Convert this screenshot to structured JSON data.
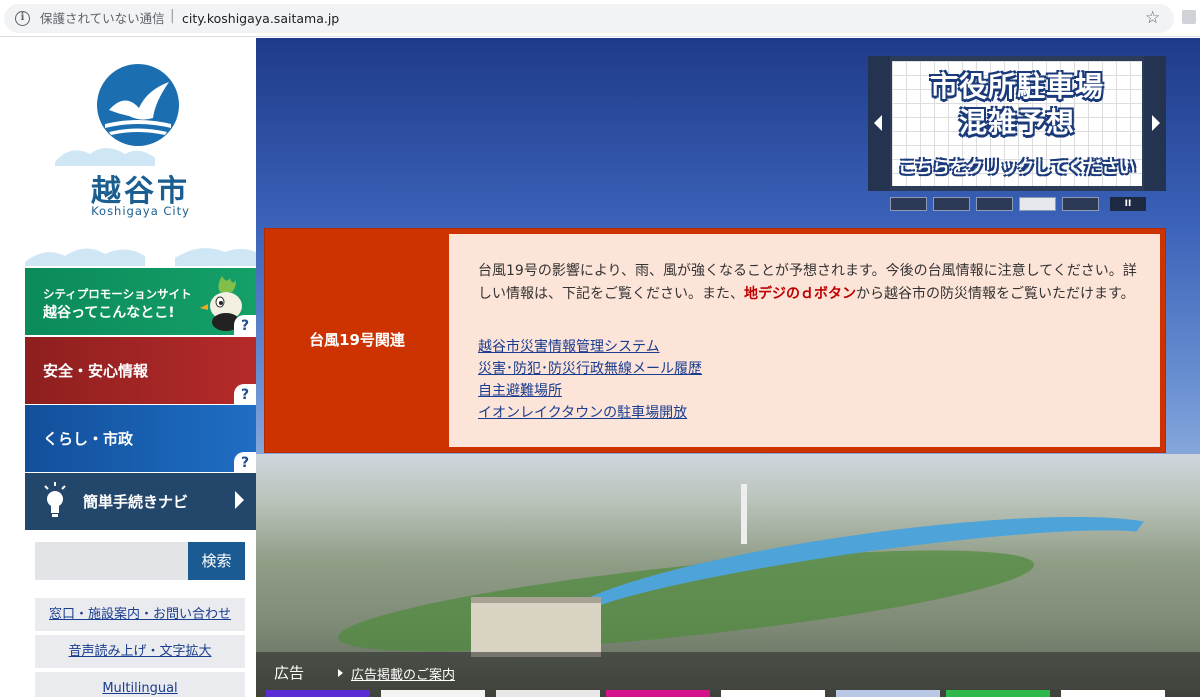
{
  "browser": {
    "security_status": "保護されていない通信",
    "separator": "|",
    "url": "city.koshigaya.saitama.jp"
  },
  "logo": {
    "city_name": "越谷市",
    "city_name_en": "Koshigaya City"
  },
  "sidebar": {
    "promo": {
      "line1": "シティプロモーションサイト",
      "line2": "越谷ってこんなとこ!"
    },
    "help_mark": "?",
    "nav": [
      {
        "label": "安全・安心情報"
      },
      {
        "label": "くらし・市政"
      },
      {
        "label": "簡単手続きナビ"
      }
    ],
    "search": {
      "placeholder": "",
      "button_label": "検索"
    },
    "links": [
      {
        "label": "窓口・施設案内・お問い合わせ"
      },
      {
        "label": "音声読み上げ・文字拡大"
      },
      {
        "label": "Multilingual"
      }
    ]
  },
  "slideshow": {
    "title_line1": "市役所駐車場",
    "title_line2": "混雑予想",
    "subtitle": "こちらをクリックしてください",
    "pause_label": "II",
    "slide_count": 5,
    "active_slide": 4
  },
  "notice": {
    "label": "台風19号関連",
    "text_before": "台風19号の影響により、雨、風が強くなることが予想されます。今後の台風情報に注意してください。詳しい情報は、下記をご覧ください。また、",
    "text_highlight": "地デジのｄボタン",
    "text_after": "から越谷市の防災情報をご覧いただけます。",
    "links": [
      "越谷市災害情報管理システム",
      "災害･防犯･防災行政無線メール履歴",
      "自主避難場所",
      "イオンレイクタウンの駐車場開放"
    ]
  },
  "ads": {
    "label": "広告",
    "link": "広告掲載のご案内"
  },
  "colors": {
    "brand_blue": "#1b5e8f",
    "notice_red": "#cc3300",
    "highlight_red": "#c00000",
    "link_blue": "#1a3d8f"
  }
}
